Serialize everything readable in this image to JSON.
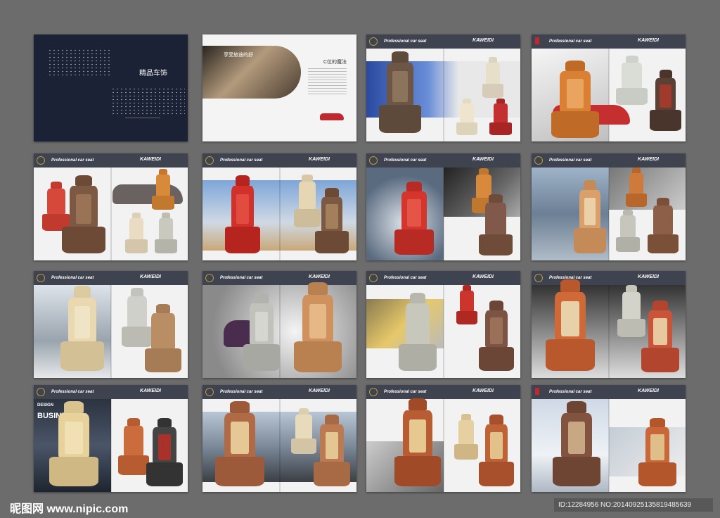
{
  "cover": {
    "title": "精品车饰"
  },
  "intro": {
    "headline": "享受旅途的舒",
    "subtitle": "C位的魔法"
  },
  "pages": {
    "header_tag": "Professional car seat",
    "brand": "KAWEIDI"
  },
  "p3": {
    "big_text": "DESIGN",
    "sub_text": "BUSINESS"
  },
  "watermark": {
    "site": "昵图网 www.nipic.com",
    "id": "ID:12284956 NO:20140925135819485639"
  },
  "colors": {
    "bg": "#6c6c6c",
    "header": "#3f4350",
    "accent": "#c1272d"
  }
}
